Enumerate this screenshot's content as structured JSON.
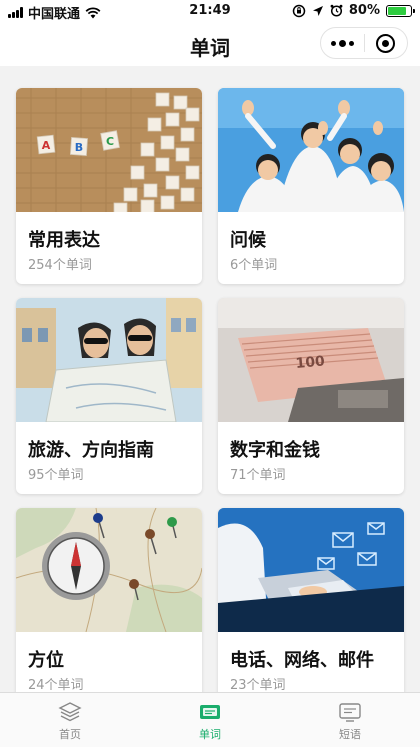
{
  "status": {
    "carrier": "中国联通",
    "time": "21:49",
    "battery": "80%",
    "battery_level": 0.8
  },
  "nav": {
    "title": "单词"
  },
  "cards": [
    {
      "title": "常用表达",
      "count": "254个单词",
      "image": "alphabet-tiles"
    },
    {
      "title": "问候",
      "count": "6个单词",
      "image": "waving-group"
    },
    {
      "title": "旅游、方向指南",
      "count": "95个单词",
      "image": "travelers-map"
    },
    {
      "title": "数字和金钱",
      "count": "71个单词",
      "image": "money-counter"
    },
    {
      "title": "方位",
      "count": "24个单词",
      "image": "compass-map"
    },
    {
      "title": "电话、网络、邮件",
      "count": "23个单词",
      "image": "laptop-email"
    }
  ],
  "tabs": [
    {
      "label": "首页",
      "icon": "layers-icon",
      "active": false
    },
    {
      "label": "单词",
      "icon": "cards-icon",
      "active": true
    },
    {
      "label": "短语",
      "icon": "screen-icon",
      "active": false
    }
  ],
  "colors": {
    "accent": "#1aad6c",
    "battery": "#2ecc40",
    "inactive": "#888888"
  }
}
